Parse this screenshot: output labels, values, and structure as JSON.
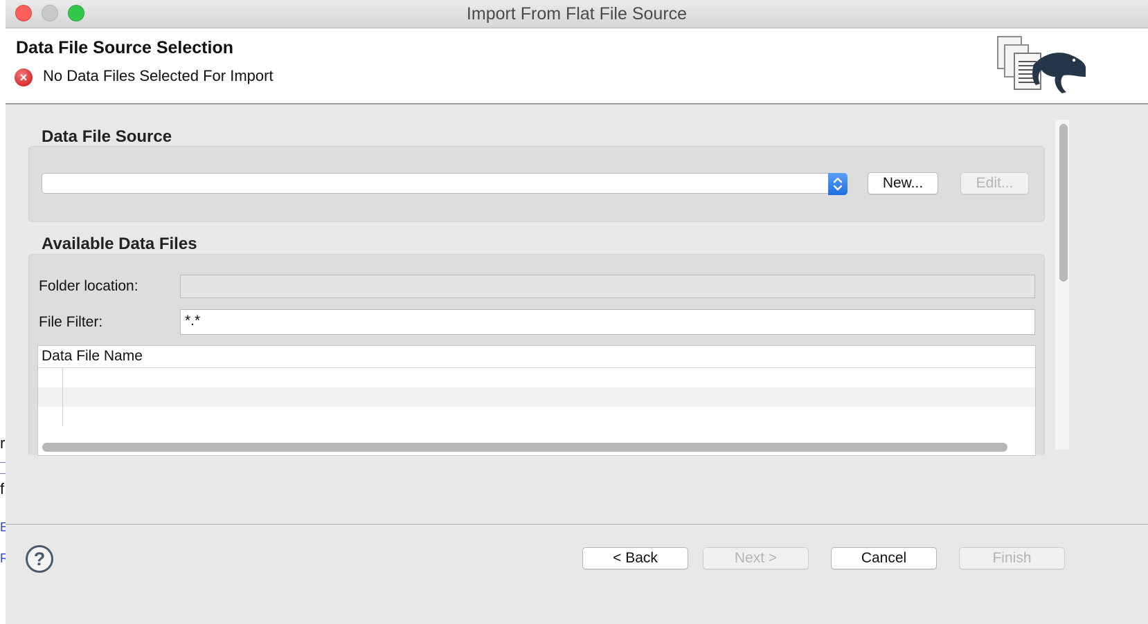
{
  "window": {
    "title": "Import From Flat File Source"
  },
  "header": {
    "title": "Data File Source Selection",
    "message": "No Data Files Selected For Import",
    "error_glyph": "×",
    "graphic_icon": "documents-lizard-icon"
  },
  "data_file_source": {
    "section_label": "Data File Source",
    "combo_value": "",
    "new_button": "New...",
    "edit_button": "Edit..."
  },
  "available_files": {
    "section_label": "Available Data Files",
    "folder_label": "Folder location:",
    "folder_value": "",
    "filter_label": "File Filter:",
    "filter_value": "*.*",
    "table": {
      "column_header": "Data File Name",
      "rows": [
        "",
        "",
        ""
      ]
    }
  },
  "footer": {
    "help_glyph": "?",
    "back_button": "< Back",
    "next_button": "Next >",
    "cancel_button": "Cancel",
    "finish_button": "Finish"
  },
  "background_app": {
    "fragments": [
      "r",
      "f",
      "E",
      "R"
    ]
  },
  "colors": {
    "error": "#d62f2f",
    "accent_blue": "#1f6fe0",
    "disabled_text": "#b4b4b4"
  }
}
